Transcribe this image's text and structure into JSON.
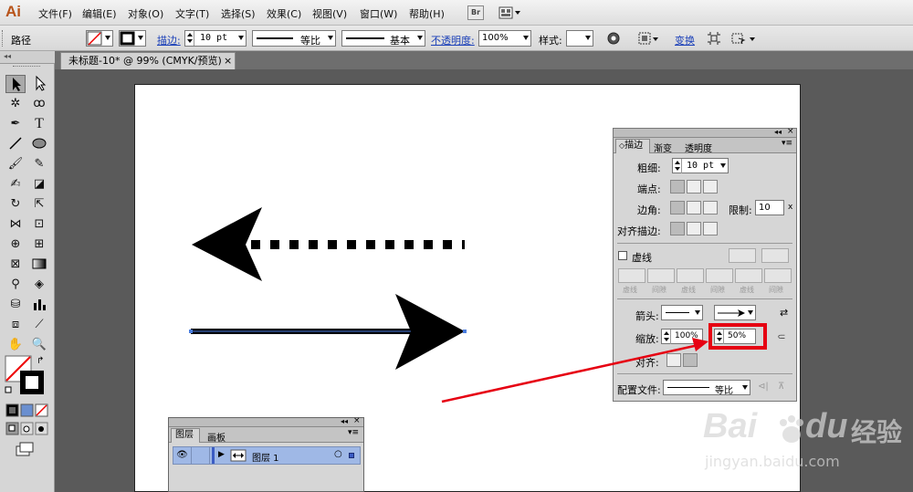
{
  "app": {
    "logo": "Ai"
  },
  "menu": [
    "文件(F)",
    "编辑(E)",
    "对象(O)",
    "文字(T)",
    "选择(S)",
    "效果(C)",
    "视图(V)",
    "窗口(W)",
    "帮助(H)"
  ],
  "bridge_button": "Br",
  "control_bar": {
    "selection_label": "路径",
    "stroke_label": "描边:",
    "stroke_weight": "10 pt",
    "profile": "等比",
    "brush": "基本",
    "opacity_label": "不透明度:",
    "opacity_value": "100%",
    "style_label": "样式:",
    "transform_label": "变换"
  },
  "document_tab": {
    "title": "未标题-10* @ 99% (CMYK/预览)",
    "close": "×"
  },
  "stroke_panel": {
    "collapse": "◂◂",
    "close": "×",
    "tabs": [
      "描边",
      "渐变",
      "透明度"
    ],
    "active_tab": "描边",
    "weight_label": "粗细:",
    "weight_value": "10 pt",
    "cap_label": "端点:",
    "corner_label": "边角:",
    "limit_label": "限制:",
    "limit_value": "10",
    "limit_unit": "x",
    "align_label": "对齐描边:",
    "dashed_label": "虚线",
    "dash_labels": [
      "虚线",
      "间隙",
      "虚线",
      "间隙",
      "虚线",
      "间隙"
    ],
    "arrowheads_label": "箭头:",
    "scale_label": "缩放:",
    "scale_start": "100%",
    "scale_end": "50%",
    "align_arrow_label": "对齐:",
    "profile_label": "配置文件:",
    "profile_value": "等比",
    "highlight_color": "#e60012"
  },
  "layers_panel": {
    "tabs": [
      "图层",
      "画板"
    ],
    "active_tab": "图层",
    "layer_name": "图层 1"
  },
  "watermark": {
    "brand": "Bai",
    "brand2": "du",
    "cn": "经验",
    "url": "jingyan.baidu.com"
  }
}
